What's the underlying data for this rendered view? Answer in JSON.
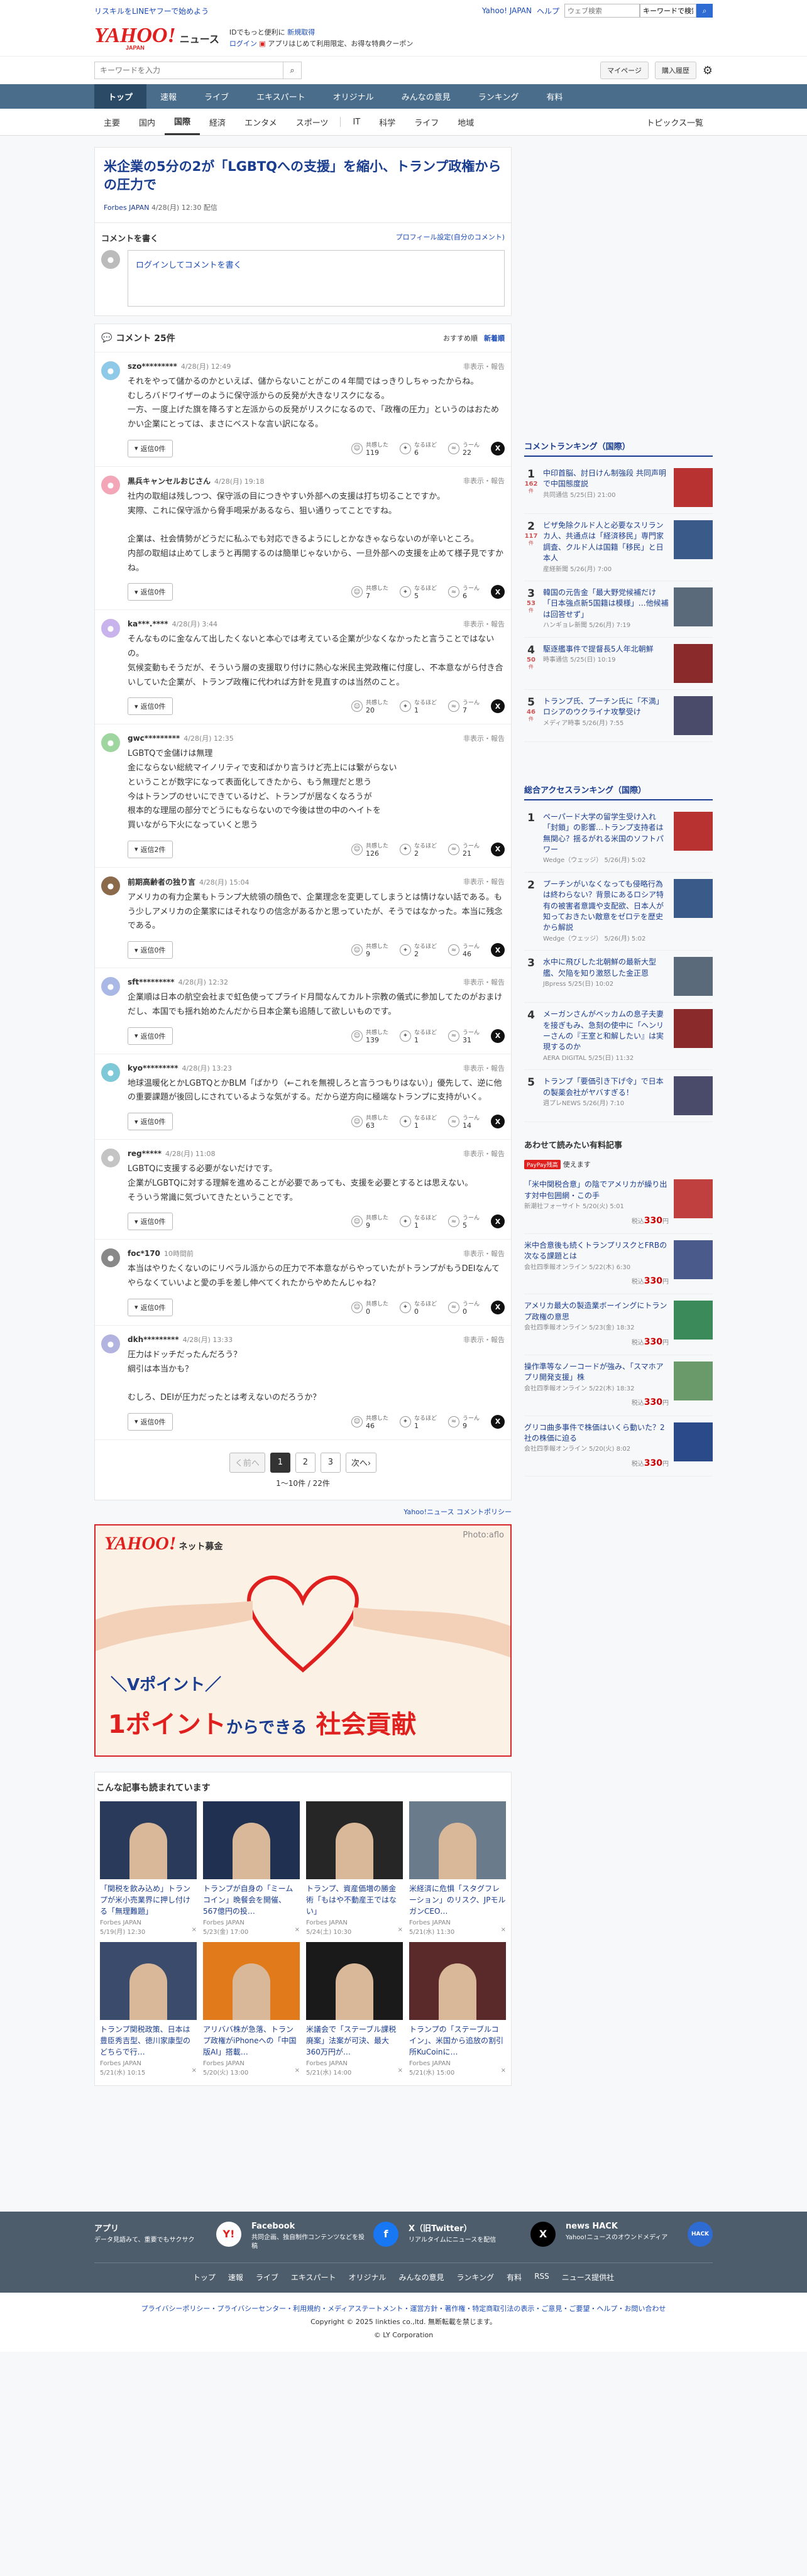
{
  "topbar": {
    "line_link": "リスキルをLINEヤフーで始めよう",
    "yj_link": "Yahoo! JAPAN",
    "help_link": "ヘルプ",
    "search_placeholder": "ウェブ検索",
    "search_value": "キーワードで検索"
  },
  "header": {
    "logo": "YAHOO!",
    "logo_sub": "JAPAN",
    "service": "ニュース",
    "msg1": "IDでもっと便利に",
    "msg1_link": "新規取得",
    "msg2_login": "ログイン",
    "msg2_app": "アプリはじめて利用限定、お得な特典クーポン"
  },
  "search": {
    "placeholder": "キーワードを入力",
    "mypage": "マイページ",
    "history": "購入履歴"
  },
  "gnav": [
    "トップ",
    "速報",
    "ライブ",
    "エキスパート",
    "オリジナル",
    "みんなの意見",
    "ランキング",
    "有料"
  ],
  "snav": [
    "主要",
    "国内",
    "国際",
    "経済",
    "エンタメ",
    "スポーツ",
    "IT",
    "科学",
    "ライフ",
    "地域"
  ],
  "snav_right": "トピックス一覧",
  "article": {
    "title": "米企業の5分の2が「LGBTQへの支援」を縮小、トランプ政権からの圧力で",
    "source": "Forbes JAPAN",
    "date": "4/28(月) 12:30 配信"
  },
  "cwrite": {
    "title": "コメントを書く",
    "profile_link": "プロフィール設定(自分のコメント)",
    "login": "ログイン",
    "placeholder": "してコメントを書く"
  },
  "clist": {
    "title": "コメント 25件",
    "sort1": "おすすめ順",
    "sort2": "新着順",
    "flag": "非表示・報告",
    "reply": "返信",
    "like": "共感した",
    "think": "なるほど",
    "hmm": "うーん"
  },
  "comments": [
    {
      "name": "szo*********",
      "date": "4/28(月) 12:49",
      "text": "それをやって儲かるのかといえば、儲からないことがこの４年間ではっきりしちゃったからね。\nむしろバドワイザーのように保守派からの反発が大きなリスクになる。\n一方、一度上げた旗を降ろすと左派からの反発がリスクになるので、「政権の圧力」というのはおためかい企業にとっては、まさにベストな言い訳になる。",
      "reply": "返信0件",
      "like": "119",
      "think": "6",
      "hmm": "22",
      "color": "#8fc9e8"
    },
    {
      "name": "黒兵キャンセルおじさん",
      "date": "4/28(月) 19:18",
      "text": "社内の取組は残しつつ、保守派の目につきやすい外部への支援は打ち切ることですか。\n実際、これに保守派から脅手喝采があるなら、狙い通りってことですね。\n\n企業は、社会情勢がどうだに私ふでも対応できるようにしとかなきゃならないのが辛いところ。\n内部の取組は止めてしまうと再開するのは簡単じゃないから、一旦外部への支援を止めて様子見ですかね。",
      "reply": "返信0件",
      "like": "7",
      "think": "5",
      "hmm": "6",
      "color": "#f3a6b8"
    },
    {
      "name": "ka***.****",
      "date": "4/28(月) 3:44",
      "text": "そんなものに金なんて出したくないと本心では考えている企業が少なくなかったと言うことではないの。\n気候変動もそうだが、そういう層の支援取り付けに熱心な米民主党政権に付度し、不本意ながら付き合いしていた企業が、トランプ政権に代われば方針を見直すのは当然のこと。",
      "reply": "返信0件",
      "like": "20",
      "think": "1",
      "hmm": "7",
      "color": "#c9b3ec"
    },
    {
      "name": "gwc*********",
      "date": "4/28(月) 12:35",
      "text": "LGBTQで金儲けは無理\n金にならない総統マイノリティで支和ばかり言うけど売上には繋がらない\nということが数字になって表面化してきたから、もう無理だと思う\n今はトランプのせいにできているけど、トランプが居なくなろうが\n根本的な理屈の部分でどうにもならないので今後は世の中のヘイトを\n買いながら下火になっていくと思う",
      "reply": "返信2件",
      "like": "126",
      "think": "2",
      "hmm": "21",
      "color": "#9fd59f"
    },
    {
      "name": "前期高齢者の独り言",
      "date": "4/28(月) 15:04",
      "text": "アメリカの有力企業もトランプ大統領の顔色で、企業理念を変更してしまうとは情けない話である。もう少しアメリカの企業家にはそれなりの信念があるかと思っていたが、そうではなかった。本当に残念である。",
      "reply": "返信0件",
      "like": "9",
      "think": "2",
      "hmm": "46",
      "color": "#8a6a4a"
    },
    {
      "name": "sft*********",
      "date": "4/28(月) 12:32",
      "text": "企業順は日本の航空会社まで虹色使ってプライド月間なんてカルト宗教の儀式に参加してたのがおまけだし、本国でも揺れ始めたんだから日本企業も追随して欲しいものです。",
      "reply": "返信0件",
      "like": "139",
      "think": "1",
      "hmm": "31",
      "color": "#aab8e6"
    },
    {
      "name": "kyo*********",
      "date": "4/28(月) 13:23",
      "text": "地球温暖化とかLGBTQとかBLM「ばかり（←これを無視しろと言うつもりはない）」優先して、逆に他の重要課題が後回しにされているような気がする。だから逆方向に極端なトランプに支持がいく。",
      "reply": "返信0件",
      "like": "63",
      "think": "1",
      "hmm": "14",
      "color": "#7ec8d8"
    },
    {
      "name": "reg*****",
      "date": "4/28(月) 11:08",
      "text": "LGBTQに支援する必要がないだけです。\n企業がLGBTQに対する理解を進めることが必要であっても、支援を必要とするとは思えない。\nそういう常識に気づいてきたということです。",
      "reply": "返信0件",
      "like": "9",
      "think": "1",
      "hmm": "5",
      "color": "#c4c4c4"
    },
    {
      "name": "foc*170",
      "date": "10時間前",
      "text": "本当はやりたくないのにリベラル派からの圧力で不本意ながらやっていたがトランプがもうDEIなんてやらなくていいよと愛の手を差し伸べてくれたからやめたんじゃね？",
      "reply": "返信0件",
      "like": "0",
      "think": "0",
      "hmm": "0",
      "color": "#888888"
    },
    {
      "name": "dkh*********",
      "date": "4/28(月) 13:33",
      "text": "圧力はドッチだったんだろう？\n綱引は本当かも？\n\nむしろ、DEIが圧力だったとは考えないのだろうか？",
      "reply": "返信0件",
      "like": "46",
      "think": "1",
      "hmm": "9",
      "color": "#b3b3e0"
    }
  ],
  "pager": {
    "prev": "く前へ",
    "pages": [
      "1",
      "2",
      "3"
    ],
    "next": "次へ›",
    "count": "1〜10件 / 22件"
  },
  "policy": "Yahoo!ニュース コメントポリシー",
  "ad": {
    "logo": "YAHOO!",
    "logo_sub": "ネット募金",
    "credit": "Photo:aflo",
    "line1": "＼Vポイント／",
    "line2a": "1ポイント",
    "line2b": "からできる",
    "line2c": "社会貢献"
  },
  "read": {
    "title": "こんな記事も読まれています",
    "items": [
      {
        "t": "「関税を飲み込め」トランプが米小売業界に押し付ける「無理難題」",
        "s": "Forbes JAPAN",
        "d": "5/19(月) 12:30"
      },
      {
        "t": "トランプが自身の「ミームコイン」晩餐会を開催、567億円の投…",
        "s": "Forbes JAPAN",
        "d": "5/23(金) 17:00"
      },
      {
        "t": "トランプ、資産価増の勝金術「もはや不動産王ではない」",
        "s": "Forbes JAPAN",
        "d": "5/24(土) 10:30"
      },
      {
        "t": "米経済に危惧「スタグフレーション」のリスク、JPモルガンCEO…",
        "s": "Forbes JAPAN",
        "d": "5/21(水) 11:30"
      },
      {
        "t": "トランプ関税政策、日本は豊臣秀吉型、徳川家康型のどちらで行…",
        "s": "Forbes JAPAN",
        "d": "5/21(水) 10:15"
      },
      {
        "t": "アリババ株が急落、トランプ政権がiPhoneへの「中国版AI」搭載…",
        "s": "Forbes JAPAN",
        "d": "5/20(火) 13:00"
      },
      {
        "t": "米議会で「ステーブル課税廃案」法案が可決、最大360万円が…",
        "s": "Forbes JAPAN",
        "d": "5/21(水) 14:00"
      },
      {
        "t": "トランプの「ステーブルコイン」、米国から追放の割引所KuCoinに…",
        "s": "Forbes JAPAN",
        "d": "5/21(水) 15:00"
      }
    ]
  },
  "rank1": {
    "title": "コメントランキング（国際）",
    "items": [
      {
        "no": "1",
        "c": "162",
        "t": "中印首脳、討日けん制強段 共同声明で中国態度説",
        "s": "共同通信 5/25(日) 21:00"
      },
      {
        "no": "2",
        "c": "117",
        "t": "ビザ免除クルド人と必要なスリランカ人、共通点は「経済移民」専門家調査、クルド人は国籍「移民」と日本人",
        "s": "産経新聞 5/26(月) 7:00"
      },
      {
        "no": "3",
        "c": "53",
        "t": "韓国の元告金「最大野党候補だけ「日本強点新5国籍は模様」…他候補は回答せず」",
        "s": "ハンギョレ新聞 5/26(月) 7:19"
      },
      {
        "no": "4",
        "c": "50",
        "t": "駆逐艦事件で提督長5人年北朝鮮",
        "s": "時事通信 5/25(日) 10:19"
      },
      {
        "no": "5",
        "c": "46",
        "t": "トランプ氏、プーチン氏に「不満」ロシアのウクライナ攻撃受け",
        "s": "メディア時事 5/26(月) 7:55"
      }
    ]
  },
  "rank2": {
    "title": "総合アクセスランキング（国際）",
    "items": [
      {
        "no": "1",
        "t": "ペーパード大学の留学生受け入れ「封鎖」の影響…トランプ支持者は無関心？揺るがれる米国のソフトパワー",
        "s": "Wedge（ウェッジ） 5/26(月) 5:02"
      },
      {
        "no": "2",
        "t": "プーチンがいなくなっても侵略行為は終わらない？背景にあるロシア特有の被害者意識や支配欲、日本人が知っておきたい敵意をゼロテを歴史から解説",
        "s": "Wedge（ウェッジ） 5/26(月) 5:02"
      },
      {
        "no": "3",
        "t": "水中に飛びした北朝鮮の最新大型艦、欠陥を知り激怒した金正恩",
        "s": "JBpress 5/25(日) 10:02"
      },
      {
        "no": "4",
        "t": "メーガンさんがベッカムの息子夫妻を接ぎもみ、急刻の使中に「ヘンリーさんの『王室と和解したい』は実現するのか",
        "s": "AERA DIGITAL 5/25(日) 11:32"
      },
      {
        "no": "5",
        "t": "トランプ「要価引き下げ令」で日本の製薬会社がヤバすぎる！",
        "s": "週プレNEWS 5/26(月) 7:10"
      }
    ]
  },
  "paid": {
    "title": "あわせて読みたい有料記事",
    "badge": "PayPay残高",
    "badge2": "使えます",
    "yen": "330",
    "unit": "円",
    "pre": "税込",
    "items": [
      {
        "t": "「米中関税合意」の陰でアメリカが繰り出す対中包囲網・この手",
        "s": "新潮社フォーサイト 5/20(火) 5:01"
      },
      {
        "t": "米中合意後も続くトランプリスクとFRBの次なる課題とは",
        "s": "会社四季報オンライン 5/22(木) 6:30"
      },
      {
        "t": "アメリカ最大の製造業ボーイングにトランプ政権の意思",
        "s": "会社四季報オンライン 5/23(金) 18:32"
      },
      {
        "t": "操作準等なノーコードが強み、「スマホアプリ開発支援」株",
        "s": "会社四季報オンライン 5/22(木) 18:32"
      },
      {
        "t": "グリコ曲多事件で株価はいくら動いた？2社の株価に迫る",
        "s": "会社四季報オンライン 5/20(火) 8:02"
      }
    ]
  },
  "footer": {
    "apps": [
      {
        "name": "アプリ",
        "desc": "データ見語みて、重要でもサクサク",
        "icon": "Y!"
      },
      {
        "name": "Facebook",
        "desc": "共同企画、独自制作コンテンツなどを投稿",
        "icon": "f"
      },
      {
        "name": "X（旧Twitter）",
        "desc": "リアルタイムにニュースを配信",
        "icon": "X"
      },
      {
        "name": "news HACK",
        "desc": "Yahoo!ニュースのオウンドメディア",
        "icon": "HACK"
      }
    ],
    "links": [
      "トップ",
      "速報",
      "ライブ",
      "エキスパート",
      "オリジナル",
      "みんなの意見",
      "ランキング",
      "有料",
      "RSS",
      "ニュース提供社"
    ],
    "bottom1": "プライバシーポリシー・プライバシーセンター・利用規約・メディアステートメント・運営方針・著作権・特定商取引法の表示・ご意見・ご要望・ヘルプ・お問い合わせ",
    "bottom2": "Copyright © 2025 linkties co.,ltd. 無断転載を禁じます。",
    "bottom3": "© LY Corporation"
  }
}
